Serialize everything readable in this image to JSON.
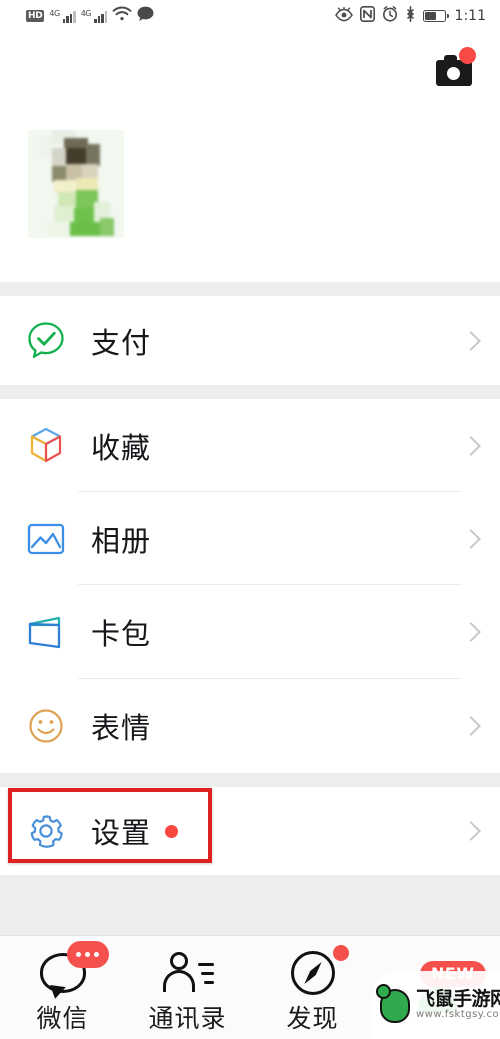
{
  "statusbar": {
    "hd_label": "HD",
    "network_label_1": "4G",
    "network_label_2": "4G",
    "time": "1:11",
    "icons": [
      "hd-icon",
      "signal-4g-icon",
      "signal-4g-second-icon",
      "wifi-icon",
      "message-bubble-icon",
      "eye-care-icon",
      "nfc-icon",
      "alarm-clock-icon",
      "bluetooth-icon",
      "battery-icon"
    ]
  },
  "header": {
    "camera_button_label": "",
    "camera_badge": ""
  },
  "profile": {
    "name_hidden": "",
    "id_hidden": ""
  },
  "menu": {
    "groups": [
      {
        "id": "pay-group",
        "items": [
          {
            "id": "pay",
            "label": "支付",
            "icon": "pay-icon",
            "icon_color": "#1aad4b",
            "badge": false
          }
        ]
      },
      {
        "id": "feature-group",
        "items": [
          {
            "id": "favorites",
            "label": "收藏",
            "icon": "favorites-cube-icon",
            "icon_color": "#f0a32e",
            "badge": false
          },
          {
            "id": "album",
            "label": "相册",
            "icon": "album-photo-icon",
            "icon_color": "#3a8ee6",
            "badge": false
          },
          {
            "id": "cards",
            "label": "卡包",
            "icon": "card-wallet-icon",
            "icon_color": "#2e9fd4",
            "badge": false
          },
          {
            "id": "stickers",
            "label": "表情",
            "icon": "sticker-smiley-icon",
            "icon_color": "#e3a04a",
            "badge": false
          }
        ]
      },
      {
        "id": "settings-group",
        "items": [
          {
            "id": "settings",
            "label": "设置",
            "icon": "gear-icon",
            "icon_color": "#4a90d9",
            "badge": true
          }
        ]
      }
    ],
    "chevron": "chevron-right-icon",
    "highlight_color": "#e02121",
    "badge_color": "#f8473f"
  },
  "tabbar": {
    "tabs": [
      {
        "id": "wechat",
        "label": "微信",
        "icon": "chat-bubble-icon",
        "badge": "dots",
        "active": false
      },
      {
        "id": "contacts",
        "label": "通讯录",
        "icon": "contacts-icon",
        "badge": "",
        "active": false
      },
      {
        "id": "discover",
        "label": "发现",
        "icon": "compass-icon",
        "badge": "dot",
        "active": false
      },
      {
        "id": "me",
        "label": "",
        "icon": "person-icon",
        "badge": "NEW",
        "active": true
      }
    ],
    "active_color": "#2bb14b",
    "badge_color": "#f4504c"
  },
  "watermark": {
    "site_name": "飞鼠手游网",
    "site_url": "www.fsktgsy.com",
    "logo": "mouse-logo-icon"
  }
}
